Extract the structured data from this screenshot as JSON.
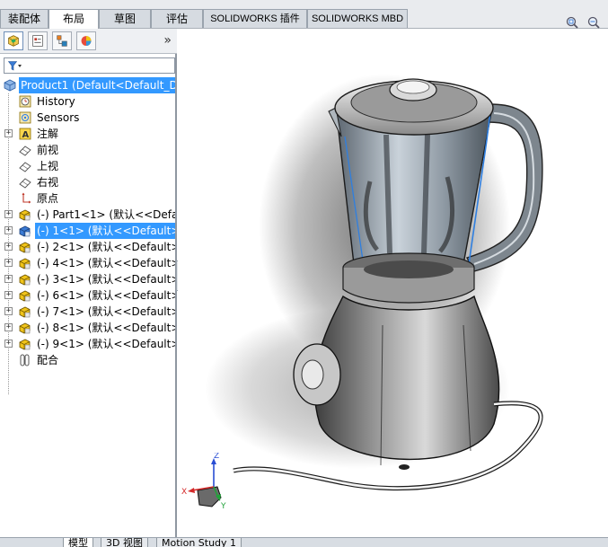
{
  "command_tabs": [
    {
      "label": "装配体",
      "active": false
    },
    {
      "label": "布局",
      "active": true
    },
    {
      "label": "草图",
      "active": false
    },
    {
      "label": "评估",
      "active": false
    },
    {
      "label": "SOLIDWORKS 插件",
      "active": false
    },
    {
      "label": "SOLIDWORKS MBD",
      "active": false
    }
  ],
  "viewport_icons": [
    "zoom-to-fit-icon",
    "zoom-to-area-icon"
  ],
  "manager_tabs": [
    "featuremanager-tree-icon",
    "property-manager-icon",
    "configuration-manager-icon",
    "display-manager-icon"
  ],
  "panel_chevron": "»",
  "tree": {
    "root": {
      "label": "Product1  (Default<Default_Di",
      "icon": "assembly-icon"
    },
    "nodes": [
      {
        "label": "History",
        "icon": "history-icon",
        "expandable": false,
        "selected": false
      },
      {
        "label": "Sensors",
        "icon": "sensors-icon",
        "expandable": false,
        "selected": false
      },
      {
        "label": "注解",
        "icon": "annotation-icon",
        "expandable": true,
        "selected": false
      },
      {
        "label": "前视",
        "icon": "plane-icon",
        "expandable": false,
        "selected": false
      },
      {
        "label": "上视",
        "icon": "plane-icon",
        "expandable": false,
        "selected": false
      },
      {
        "label": "右视",
        "icon": "plane-icon",
        "expandable": false,
        "selected": false
      },
      {
        "label": "原点",
        "icon": "origin-icon",
        "expandable": false,
        "selected": false
      },
      {
        "label": "(-) Part1<1> (默认<<Defau",
        "icon": "part-icon",
        "expandable": true,
        "selected": false
      },
      {
        "label": "(-) 1<1> (默认<<Default>_",
        "icon": "part-icon",
        "expandable": true,
        "selected": true
      },
      {
        "label": "(-) 2<1> (默认<<Default>_",
        "icon": "part-icon",
        "expandable": true,
        "selected": false
      },
      {
        "label": "(-) 4<1> (默认<<Default>_",
        "icon": "part-icon",
        "expandable": true,
        "selected": false
      },
      {
        "label": "(-) 3<1> (默认<<Default>_",
        "icon": "part-icon",
        "expandable": true,
        "selected": false
      },
      {
        "label": "(-) 6<1> (默认<<Default>_",
        "icon": "part-icon",
        "expandable": true,
        "selected": false
      },
      {
        "label": "(-) 7<1> (默认<<Default>_",
        "icon": "part-icon",
        "expandable": true,
        "selected": false
      },
      {
        "label": "(-) 8<1> (默认<<Default>_",
        "icon": "part-icon",
        "expandable": true,
        "selected": false
      },
      {
        "label": "(-) 9<1> (默认<<Default>_",
        "icon": "part-icon",
        "expandable": true,
        "selected": false
      },
      {
        "label": "配合",
        "icon": "mates-icon",
        "expandable": false,
        "selected": false
      }
    ]
  },
  "bottom_tabs": [
    {
      "label": "模型",
      "active": true
    },
    {
      "label": "3D 视图",
      "active": false
    },
    {
      "label": "Motion Study 1",
      "active": false
    }
  ],
  "triad": {
    "x": "X",
    "y": "Y",
    "z": "Z"
  },
  "colors": {
    "selection": "#3399ff",
    "edge_highlight": "#2f7fe0",
    "triad_x": "#d42a2a",
    "triad_y": "#22a23a",
    "triad_z": "#2a4ed4"
  }
}
